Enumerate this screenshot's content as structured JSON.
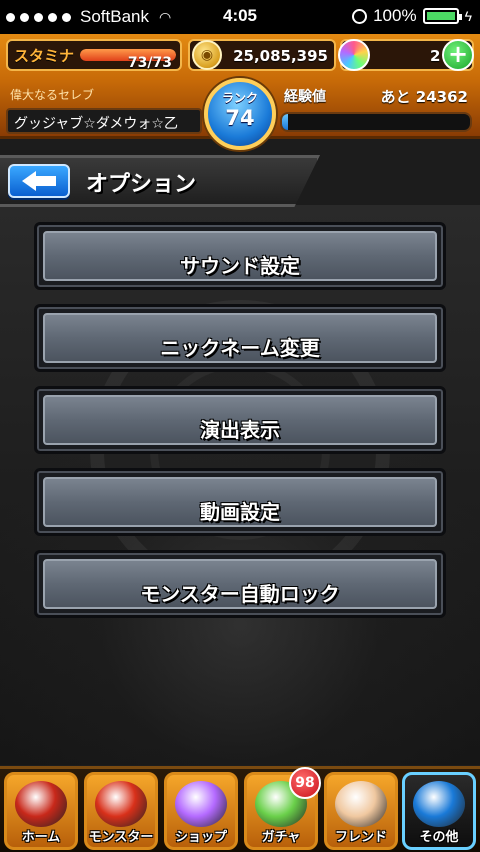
{
  "status_bar": {
    "carrier": "SoftBank",
    "time": "4:05",
    "battery": "100%"
  },
  "header": {
    "stamina_label": "スタミナ",
    "stamina_value": "73/73",
    "stamina_fraction": 1.0,
    "coins": "25,085,395",
    "orbs": "2",
    "title": "偉大なるセレブ",
    "player_name": "グッジャブ☆ダメウォ☆乙",
    "rank_label": "ランク",
    "rank_value": "74",
    "exp_label": "経験値",
    "exp_remaining": "あと 24362",
    "exp_fraction": 0.03,
    "plus_label": "+"
  },
  "page": {
    "title": "オプション"
  },
  "options": [
    {
      "label": "サウンド設定"
    },
    {
      "label": "ニックネーム変更"
    },
    {
      "label": "演出表示"
    },
    {
      "label": "動画設定"
    },
    {
      "label": "モンスター自動ロック"
    }
  ],
  "nav": {
    "items": [
      {
        "label": "ホーム",
        "icon": "home-icon",
        "color": "#c8281a"
      },
      {
        "label": "モンスター",
        "icon": "monster-icon",
        "color": "#d8301a"
      },
      {
        "label": "ショップ",
        "icon": "shop-orb-icon",
        "color": "#b46aff"
      },
      {
        "label": "ガチャ",
        "icon": "gacha-egg-icon",
        "color": "#6ad04a"
      },
      {
        "label": "フレンド",
        "icon": "friend-handshake-icon",
        "color": "#f0c8a0"
      },
      {
        "label": "その他",
        "icon": "other-icon",
        "color": "#1a7ad8"
      }
    ],
    "gacha_badge": "98"
  }
}
